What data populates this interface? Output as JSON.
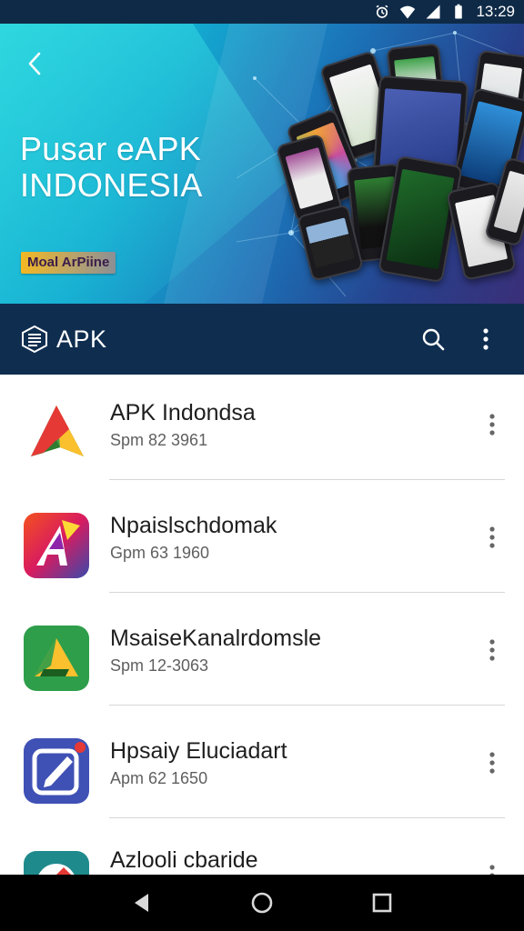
{
  "status_bar": {
    "time": "13:29",
    "icons": [
      "alarm-icon",
      "wifi-icon",
      "signal-icon",
      "battery-icon"
    ]
  },
  "banner": {
    "title_line1": "Pusar eAPK",
    "title_line2": "INDONESIA",
    "badge": "Moal ArPiine"
  },
  "app_bar": {
    "title": "APK",
    "background": "#0f2d4f"
  },
  "apps": [
    {
      "name": "APK Indondsa",
      "subtitle": "Spm 82 3961",
      "icon": "green-a-app-icon"
    },
    {
      "name": "Npaislschdomak",
      "subtitle": "Gpm 63 1960",
      "icon": "colorful-a-app-icon"
    },
    {
      "name": "MsaiseKanalrdomsle",
      "subtitle": "Spm 12-3063",
      "icon": "green-yellow-a-app-icon"
    },
    {
      "name": "Hpsaiy Eluciadart",
      "subtitle": "Apm 62 1650",
      "icon": "blue-edit-app-icon"
    },
    {
      "name": "Azlooli cbaride",
      "subtitle": "",
      "icon": "paint-app-icon"
    }
  ],
  "colors": {
    "status_bar": "#0e2a47",
    "nav_bar": "#000000",
    "banner_start": "#1fc7d8",
    "banner_end": "#3a2f78"
  }
}
